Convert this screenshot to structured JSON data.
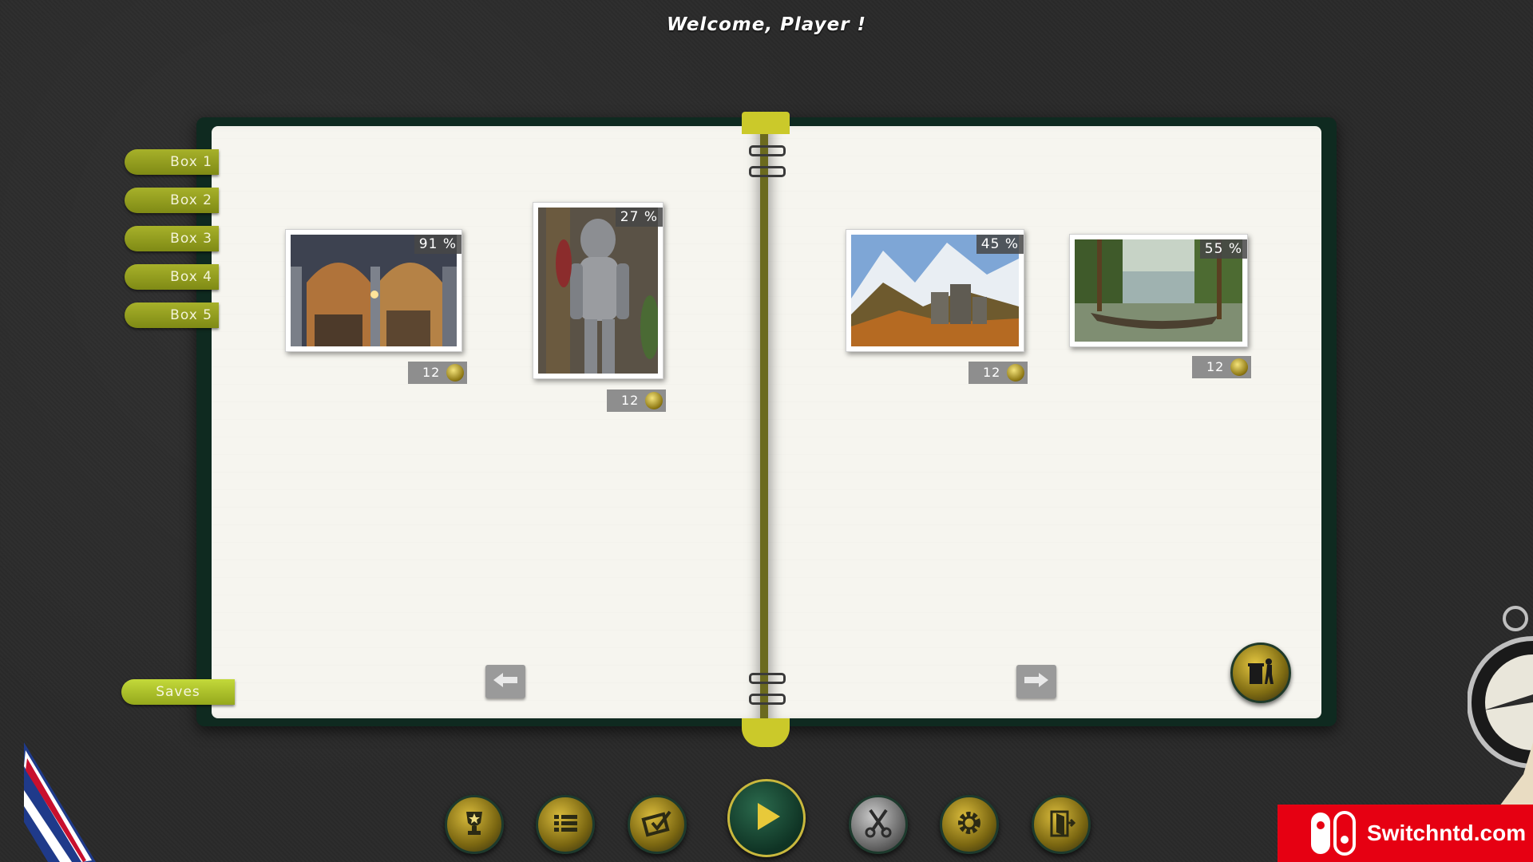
{
  "header": {
    "welcome": "Welcome, Player !"
  },
  "tabs": [
    {
      "label": "Box 1"
    },
    {
      "label": "Box 2"
    },
    {
      "label": "Box 3"
    },
    {
      "label": "Box 4"
    },
    {
      "label": "Box 5"
    }
  ],
  "saves": {
    "label": "Saves"
  },
  "puzzles": [
    {
      "percent": "91 %",
      "pieces": "12",
      "subject": "archway"
    },
    {
      "percent": "27 %",
      "pieces": "12",
      "subject": "knight-armor"
    },
    {
      "percent": "45 %",
      "pieces": "12",
      "subject": "mountain-castle"
    },
    {
      "percent": "55 %",
      "pieces": "12",
      "subject": "lake-boat"
    }
  ],
  "toolbar": [
    {
      "icon": "trophy-icon"
    },
    {
      "icon": "list-icon"
    },
    {
      "icon": "checkbox-icon"
    },
    {
      "icon": "play-icon"
    },
    {
      "icon": "scissors-icon"
    },
    {
      "icon": "gear-icon"
    },
    {
      "icon": "exit-door-icon"
    }
  ],
  "watermark": {
    "text": "Switchntd.com"
  },
  "colors": {
    "accent_green": "#a7b12a",
    "book_cover": "#0f2a20",
    "brand_red": "#e60012"
  }
}
